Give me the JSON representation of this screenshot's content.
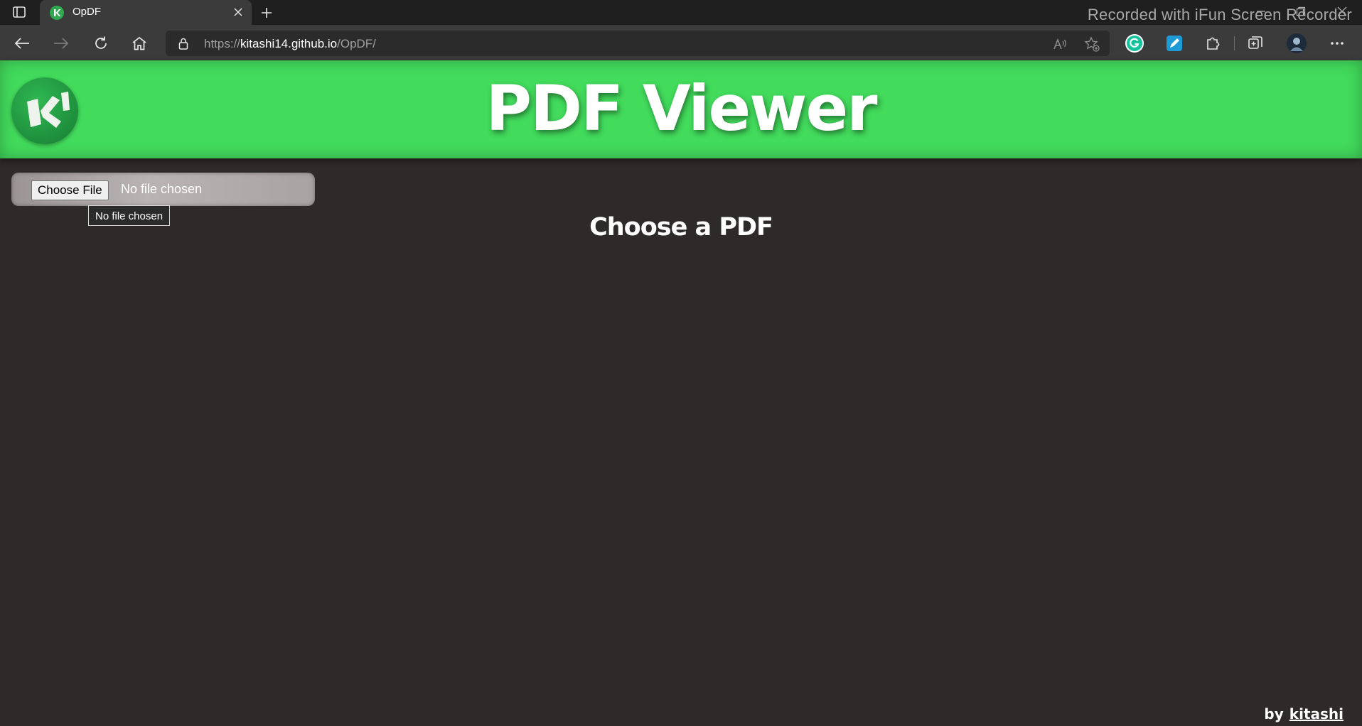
{
  "browser": {
    "tab_title": "OpDF",
    "url_scheme": "https://",
    "url_host": "kitashi14.github.io",
    "url_path": "/OpDF/",
    "watermark": "Recorded with iFun Screen Recorder",
    "icons": {
      "tab_actions": "tab-actions-icon",
      "close": "close-icon",
      "new_tab": "plus-icon",
      "back": "back-arrow-icon",
      "forward": "forward-arrow-icon",
      "refresh": "refresh-icon",
      "home": "home-icon",
      "lock": "lock-icon",
      "read_aloud": "read-aloud-icon",
      "favorite": "add-favorite-icon",
      "grammarly": "grammarly-icon",
      "pen": "pen-extension-icon",
      "extensions": "puzzle-icon",
      "collections": "collections-icon",
      "profile": "avatar",
      "more": "more-icon"
    }
  },
  "header": {
    "title": "PDF Viewer",
    "logo_text": "K",
    "accent_color": "#42db5c"
  },
  "file_input": {
    "button_label": "Choose File",
    "status": "No file chosen",
    "tooltip": "No file chosen"
  },
  "main": {
    "prompt": "Choose a PDF"
  },
  "footer": {
    "by_label": "by",
    "author": "kitashi"
  }
}
